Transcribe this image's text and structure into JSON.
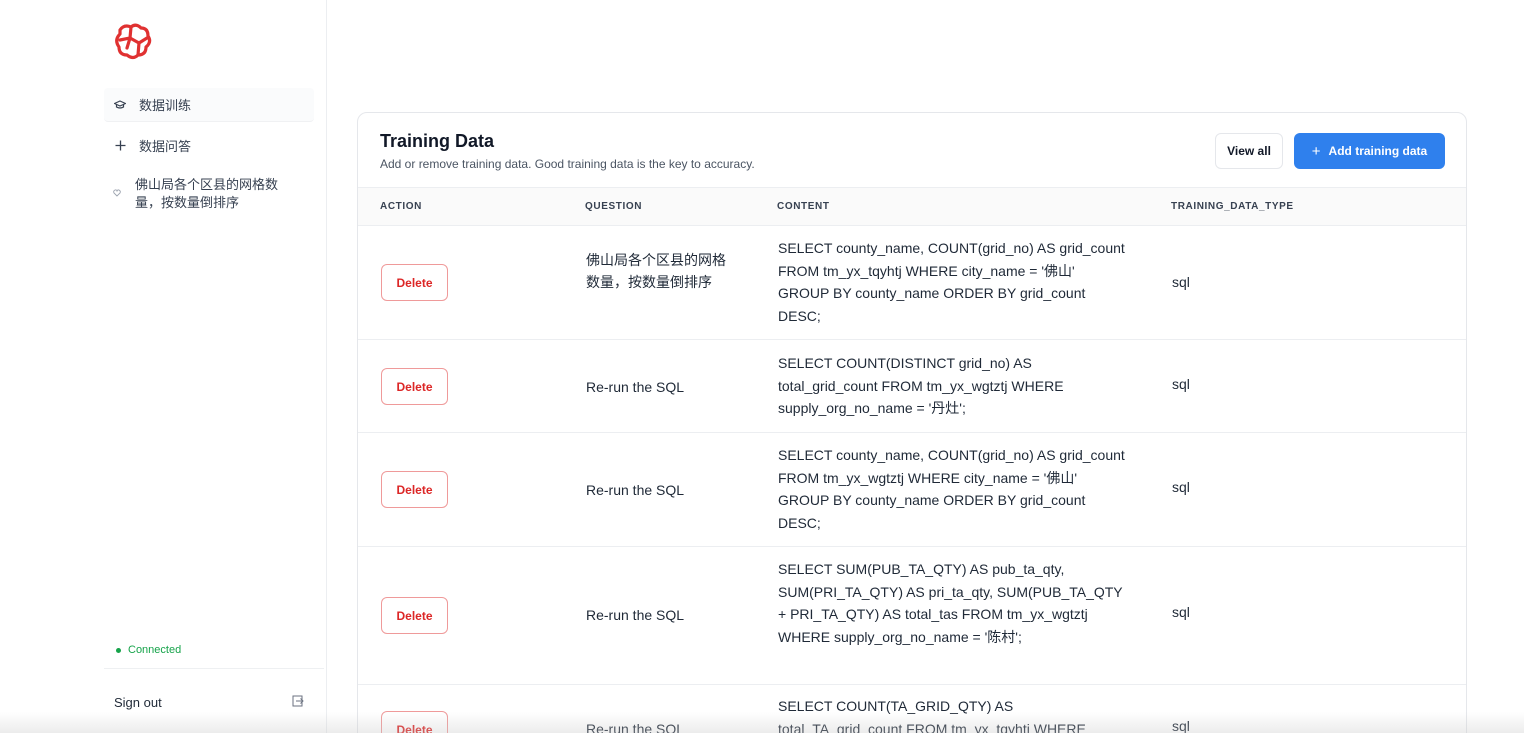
{
  "sidebar": {
    "nav": [
      {
        "label": "数据训练",
        "icon": "graduation-cap-icon"
      },
      {
        "label": "数据问答",
        "icon": "plus-icon"
      }
    ],
    "history": [
      {
        "label": "佛山局各个区县的网格数量，按数量倒排序",
        "icon": "bullet-icon"
      }
    ],
    "status": "Connected",
    "signout_label": "Sign out"
  },
  "card": {
    "title": "Training Data",
    "subtitle": "Add or remove training data. Good training data is the key to accuracy.",
    "view_all_label": "View all",
    "add_label": "Add training data"
  },
  "table": {
    "columns": [
      "ACTION",
      "QUESTION",
      "CONTENT",
      "TRAINING_DATA_TYPE"
    ],
    "delete_label": "Delete",
    "rows": [
      {
        "question": "佛山局各个区县的网格数量，按数量倒排序",
        "content": "SELECT county_name, COUNT(grid_no) AS grid_count FROM tm_yx_tqyhtj WHERE city_name = '佛山' GROUP BY county_name ORDER BY grid_count DESC;",
        "type": "sql"
      },
      {
        "question": "Re-run the SQL",
        "content": "SELECT COUNT(DISTINCT grid_no) AS total_grid_count FROM tm_yx_wgtztj WHERE supply_org_no_name = '丹灶';",
        "type": "sql"
      },
      {
        "question": "Re-run the SQL",
        "content": "SELECT county_name, COUNT(grid_no) AS grid_count FROM tm_yx_wgtztj WHERE city_name = '佛山' GROUP BY county_name ORDER BY grid_count DESC;",
        "type": "sql"
      },
      {
        "question": "Re-run the SQL",
        "content": "SELECT SUM(PUB_TA_QTY) AS pub_ta_qty, SUM(PRI_TA_QTY) AS pri_ta_qty, SUM(PUB_TA_QTY + PRI_TA_QTY) AS total_tas FROM tm_yx_wgtztj WHERE supply_org_no_name = '陈村';",
        "type": "sql"
      },
      {
        "question": "Re-run the SQL",
        "content": "SELECT COUNT(TA_GRID_QTY) AS total_TA_grid_count FROM tm_yx_tqyhtj WHERE",
        "type": "sql"
      }
    ]
  },
  "colors": {
    "primary": "#2f80ed",
    "danger": "#dc2626",
    "success": "#16a34a",
    "logo": "#e03131"
  }
}
